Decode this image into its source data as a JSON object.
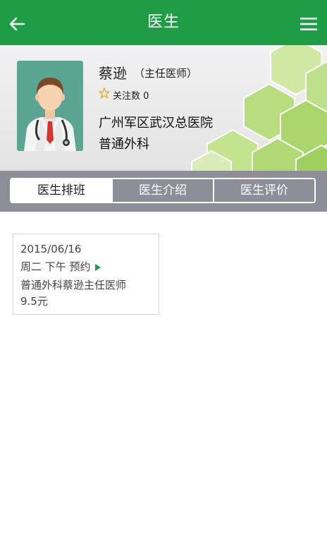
{
  "header": {
    "title": "医生"
  },
  "profile": {
    "name": "蔡逊",
    "title": "（主任医师）",
    "follow_label": "关注数",
    "follow_count": "0",
    "hospital": "广州军区武汉总医院",
    "department": "普通外科"
  },
  "tabs": [
    {
      "label": "医生排班",
      "active": true
    },
    {
      "label": "医生介绍",
      "active": false
    },
    {
      "label": "医生评价",
      "active": false
    }
  ],
  "schedule": [
    {
      "date": "2015/06/16",
      "slot": "周二 下午 预约",
      "description": "普通外科蔡逊主任医师",
      "price": "9.5元"
    }
  ],
  "colors": {
    "brand_green": "#1e9d47",
    "tabbar_gray": "#8e8e99",
    "avatar_bg": "#5aa692"
  }
}
